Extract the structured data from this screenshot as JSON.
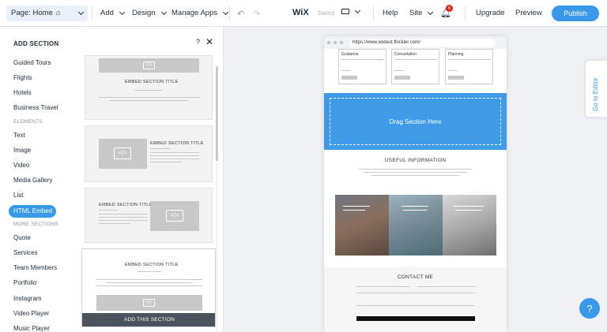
{
  "topbar": {
    "page_select": "Page: Home",
    "add": "Add",
    "design": "Design",
    "manage_apps": "Manage Apps",
    "logo": "WiX",
    "saved": "Saved",
    "help": "Help",
    "site": "Site",
    "notifications_count": "6",
    "upgrade": "Upgrade",
    "preview": "Preview",
    "publish": "Publish"
  },
  "panel": {
    "title": "ADD SECTION",
    "help": "?",
    "close": "✕",
    "categories_top": [
      "Guided Tours",
      "Flights",
      "Hotels",
      "Business Travel"
    ],
    "elements_heading": "ELEMENTS",
    "elements": [
      "Text",
      "Image",
      "Video",
      "Media Gallery",
      "List"
    ],
    "active": "HTML Embed",
    "more_heading": "MORE SECTIONS",
    "more": [
      "Quote",
      "Services",
      "Team Members",
      "Portfolio",
      "Instagram",
      "Video Player",
      "Music Player"
    ],
    "thumb_title": "EMBED SECTION TITLE",
    "add_button": "ADD THIS SECTION"
  },
  "preview": {
    "url": "https://www.wixtest.flockler.com/",
    "cards": [
      "Guidance",
      "Consultation",
      "Planning"
    ],
    "drag_text": "Drag Section Here",
    "useful": "USEFUL INFORMATION",
    "contact": "CONTACT ME"
  },
  "side": {
    "go_to_editor": "Go to Editor",
    "help": "?"
  },
  "colors": {
    "accent": "#3899ec",
    "drag": "#3f9be8"
  }
}
